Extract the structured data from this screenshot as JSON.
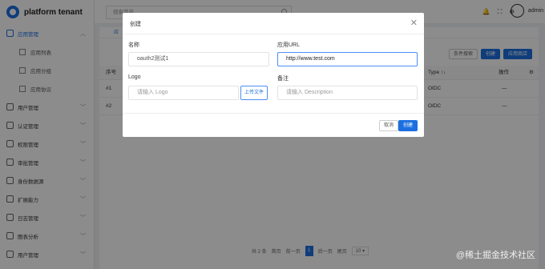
{
  "brand": {
    "title": "platform tenant"
  },
  "topbar": {
    "search_placeholder": "搜索菜单",
    "user": "admin"
  },
  "sidebar": {
    "items": [
      {
        "label": "应用管理",
        "active": true,
        "icon": "grid-icon"
      },
      {
        "label": "用户管理",
        "icon": "user-icon"
      },
      {
        "label": "认证管理",
        "icon": "shield-icon"
      },
      {
        "label": "权限管理",
        "icon": "list-icon"
      },
      {
        "label": "审批管理",
        "icon": "check-circle-icon"
      },
      {
        "label": "身份数据源",
        "icon": "database-icon"
      },
      {
        "label": "扩展能力",
        "icon": "code-icon"
      },
      {
        "label": "日志管理",
        "icon": "file-icon"
      },
      {
        "label": "图表分析",
        "icon": "chart-icon"
      },
      {
        "label": "用户管理",
        "icon": "user-icon"
      }
    ],
    "sub_items": [
      {
        "label": "应用列表",
        "icon": "list-icon"
      },
      {
        "label": "应用分组",
        "icon": "folder-icon"
      },
      {
        "label": "应用协议",
        "icon": "doc-icon"
      }
    ]
  },
  "content": {
    "tab": "应",
    "buttons": {
      "filter": "条件搜索",
      "create": "创建",
      "store": "应用商店"
    },
    "columns": {
      "seq": "序号",
      "type": "Type ↑↓",
      "ops": "操作"
    },
    "rows": [
      {
        "seq": "#1",
        "type": "OIDC",
        "ops": "—"
      },
      {
        "seq": "#2",
        "type": "OIDC",
        "ops": "—"
      }
    ],
    "pager": {
      "total": "共 2 条",
      "first": "首页",
      "prev": "前一页",
      "page": "1",
      "next": "后一页",
      "last": "尾页",
      "size": "10 ▾"
    }
  },
  "modal": {
    "title": "创建",
    "name_label": "名称",
    "name_value": "oauth2测试1",
    "url_label": "应用URL",
    "url_value": "http://www.test.com",
    "logo_label": "Logo",
    "logo_placeholder": "请输入 Logo",
    "upload_label": "上传文件",
    "note_label": "备注",
    "note_placeholder": "请输入 Description",
    "cancel_label": "取消",
    "create_label": "创建"
  },
  "watermark": "@稀土掘金技术社区",
  "colors": {
    "accent": "#1d6fe0",
    "focus": "#4c8ef5"
  }
}
